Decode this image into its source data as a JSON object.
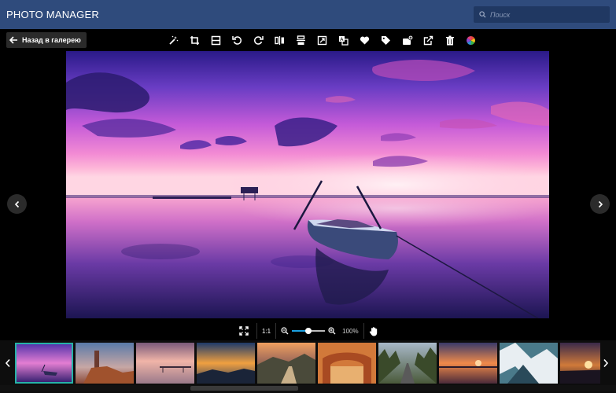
{
  "header": {
    "title": "PHOTO MANAGER",
    "search_placeholder": "Поиск"
  },
  "toolbar": {
    "back_label": "Назад в галерею",
    "tools": [
      "magic-wand-icon",
      "crop-icon",
      "frame-icon",
      "rotate-left-icon",
      "rotate-right-icon",
      "flip-horizontal-icon",
      "flip-vertical-icon",
      "resize-icon",
      "translate-icon",
      "heart-icon",
      "tag-icon",
      "add-to-album-icon",
      "share-icon",
      "trash-icon",
      "color-wheel-icon"
    ]
  },
  "viewer": {
    "image": "pink-sunset-boat-on-lake"
  },
  "zoom": {
    "actual_size_label": "1:1",
    "level_label": "100%",
    "level_fraction": 0.5
  },
  "filmstrip": {
    "thumbnails": [
      {
        "name": "pink-sunset-boat",
        "selected": true
      },
      {
        "name": "lighthouse-rocks",
        "selected": false
      },
      {
        "name": "pier-at-dusk",
        "selected": false
      },
      {
        "name": "sunset-over-rocks",
        "selected": false
      },
      {
        "name": "mountain-road-sunset",
        "selected": false
      },
      {
        "name": "stone-arch-canyon",
        "selected": false
      },
      {
        "name": "forest-road",
        "selected": false
      },
      {
        "name": "sunset-lake",
        "selected": false
      },
      {
        "name": "mountain-aerial",
        "selected": false
      },
      {
        "name": "golden-sunset",
        "selected": false
      }
    ]
  },
  "colors": {
    "header_bg": "#2f4b7c",
    "search_bg": "#203862",
    "accent": "#1a9fe0",
    "selected_border": "#26b3a8"
  }
}
